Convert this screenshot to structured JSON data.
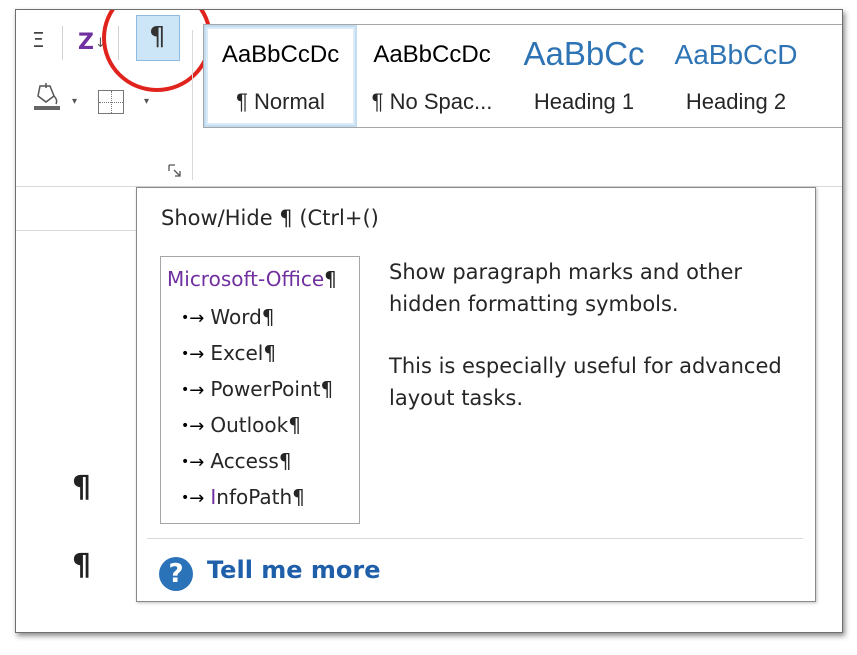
{
  "ribbon": {
    "sort_glyph": "Z",
    "sort_arrow": "↓",
    "show_hide_glyph": "¶",
    "list_glyph": "Ξ",
    "dropdown_caret": "▾",
    "styles": [
      {
        "sample": "AaBbCcDc",
        "name": "¶ Normal",
        "kind": "body",
        "selected": true
      },
      {
        "sample": "AaBbCcDc",
        "name": "¶ No Spac...",
        "kind": "body",
        "selected": false
      },
      {
        "sample": "AaBbCc",
        "name": "Heading 1",
        "kind": "h1",
        "selected": false
      },
      {
        "sample": "AaBbCcD",
        "name": "Heading 2",
        "kind": "h2",
        "selected": false
      }
    ],
    "highlight_color": "#e0231d"
  },
  "document": {
    "marks": [
      "¶",
      "¶"
    ]
  },
  "tooltip": {
    "title": "Show/Hide ¶ (Ctrl+()",
    "preview": {
      "heading": "Microsoft-Office",
      "pilcrow": "¶",
      "bullet": "•",
      "tab_arrow": "→",
      "items": [
        {
          "lead": "",
          "rest": "Word"
        },
        {
          "lead": "",
          "rest": "Excel"
        },
        {
          "lead": "",
          "rest": "PowerPoint"
        },
        {
          "lead": "",
          "rest": "Outlook"
        },
        {
          "lead": "",
          "rest": "Access"
        },
        {
          "lead": "I",
          "rest": "nfoPath"
        }
      ]
    },
    "description": [
      "Show paragraph marks and other hidden formatting symbols.",
      "This is especially useful for advanced layout tasks."
    ],
    "help_icon": "?",
    "tell_me_more": "Tell me more",
    "link_color": "#1f5ea8"
  }
}
